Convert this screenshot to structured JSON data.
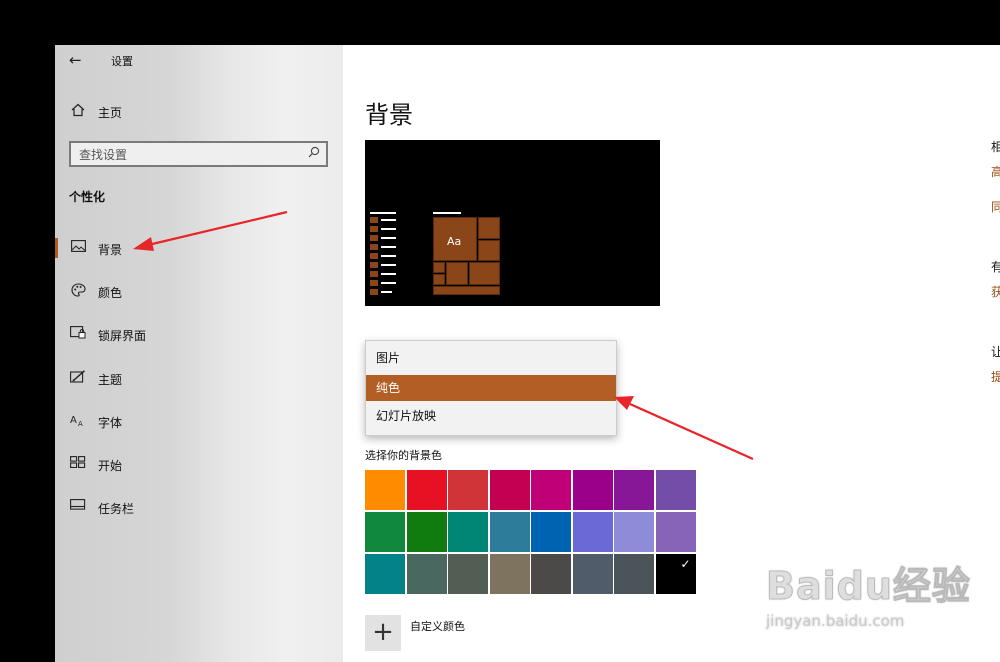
{
  "window": {
    "title": "设置"
  },
  "sidebar": {
    "home_label": "主页",
    "search_placeholder": "查找设置",
    "section_title": "个性化",
    "items": [
      {
        "label": "背景",
        "icon": "picture-icon",
        "active": true
      },
      {
        "label": "颜色",
        "icon": "palette-icon",
        "active": false
      },
      {
        "label": "锁屏界面",
        "icon": "lock-screen-icon",
        "active": false
      },
      {
        "label": "主题",
        "icon": "theme-brush-icon",
        "active": false
      },
      {
        "label": "字体",
        "icon": "font-icon",
        "active": false
      },
      {
        "label": "开始",
        "icon": "start-grid-icon",
        "active": false
      },
      {
        "label": "任务栏",
        "icon": "taskbar-icon",
        "active": false
      }
    ]
  },
  "main": {
    "title": "背景",
    "preview": {
      "sample_text": "Aa"
    },
    "dropdown": {
      "options": [
        "图片",
        "纯色",
        "幻灯片放映"
      ],
      "selected": "纯色"
    },
    "color_label": "选择你的背景色",
    "swatches": [
      [
        "#ff8c00",
        "#e81123",
        "#d13438",
        "#c30052",
        "#bf0077",
        "#9a0089",
        "#881798",
        "#744da9"
      ],
      [
        "#10893e",
        "#107c10",
        "#018574",
        "#2d7d9a",
        "#0063b1",
        "#6b69d6",
        "#8e8cd8",
        "#8764b8"
      ],
      [
        "#038387",
        "#486860",
        "#525e54",
        "#7e735f",
        "#4c4a48",
        "#515c6b",
        "#4a5459",
        "#000000"
      ]
    ],
    "selected_swatch": "#000000",
    "custom_label": "自定义颜色"
  },
  "right_panel": {
    "items": [
      {
        "text": "相",
        "type": "heading"
      },
      {
        "text": "高",
        "type": "link"
      },
      {
        "text": "同",
        "type": "link"
      },
      {
        "text": "有",
        "type": "heading"
      },
      {
        "text": "获",
        "type": "link"
      },
      {
        "text": "让",
        "type": "heading"
      },
      {
        "text": "提",
        "type": "link"
      }
    ]
  },
  "colors": {
    "accent": "#b35e25",
    "annotation_arrow": "#e8262a"
  },
  "watermark": {
    "brand": "Baidu经验",
    "url": "jingyan.baidu.com"
  }
}
